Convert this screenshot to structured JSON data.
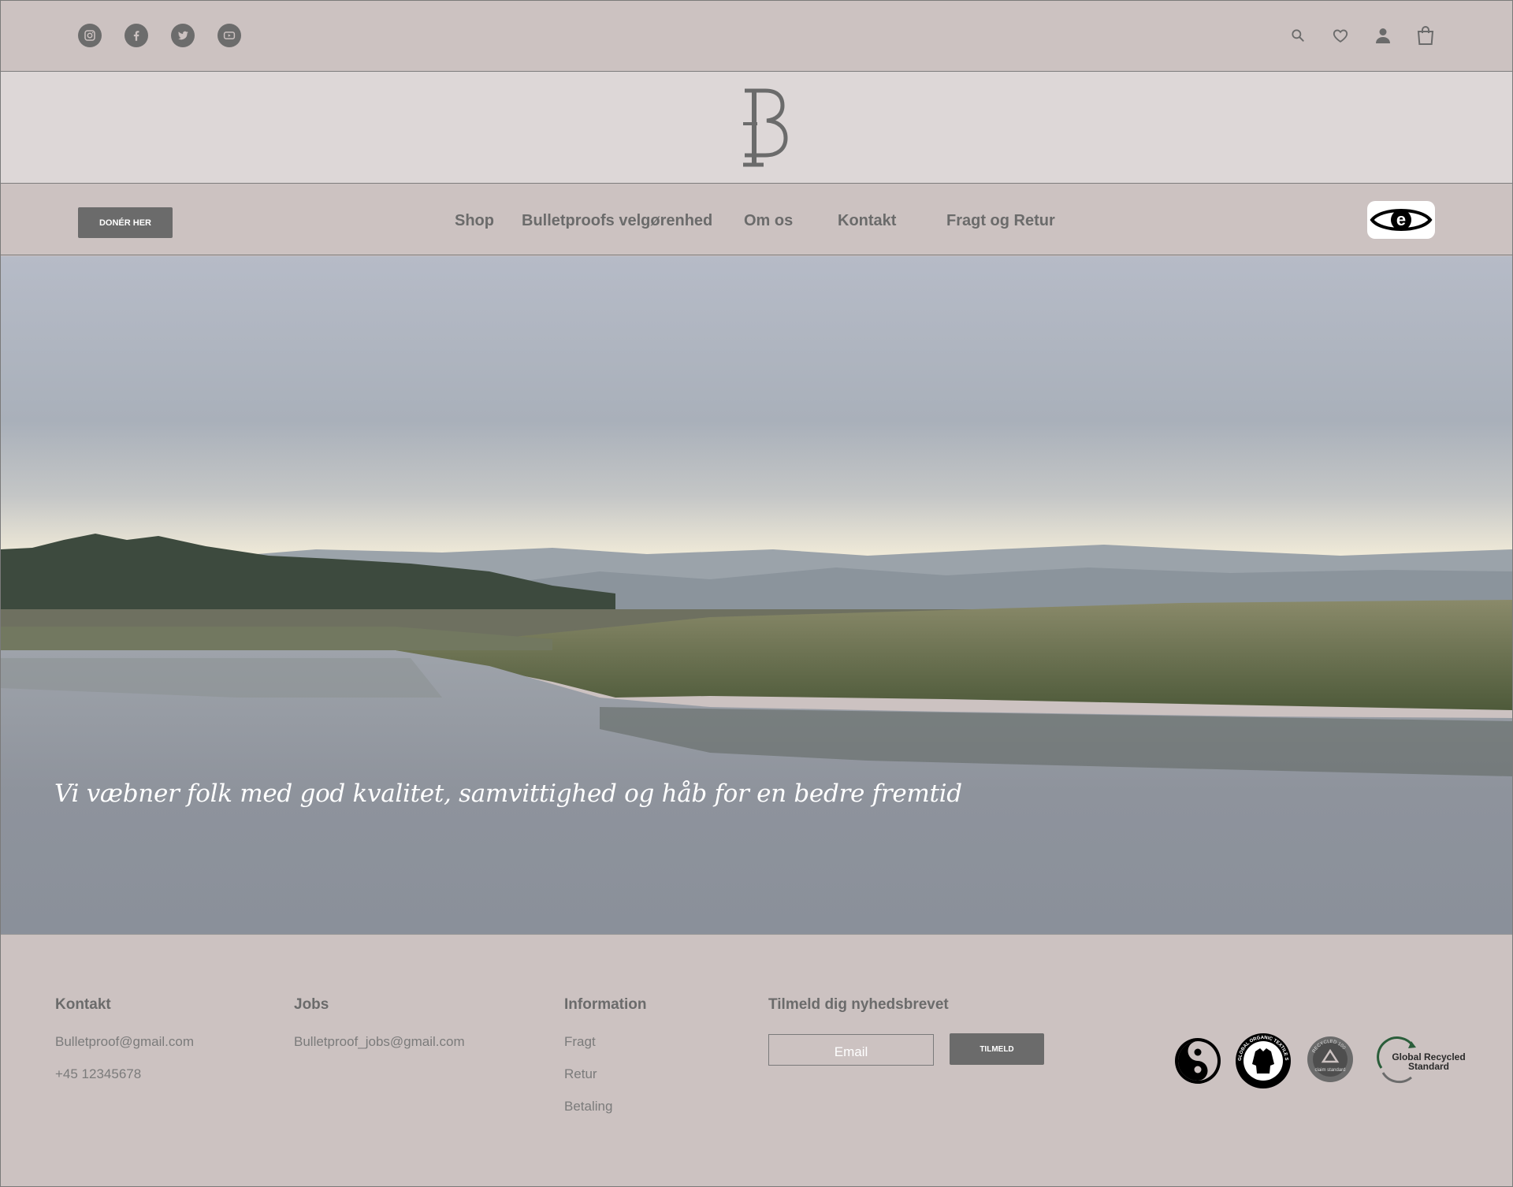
{
  "header": {
    "social_icons": [
      "instagram-icon",
      "facebook-icon",
      "twitter-icon",
      "youtube-icon"
    ],
    "utility_icons": [
      "search-icon",
      "heart-icon",
      "user-icon",
      "bag-icon"
    ]
  },
  "nav": {
    "donate_label": "DONÉR HER",
    "items": [
      {
        "label": "Shop"
      },
      {
        "label": "Bulletproofs velgørenhed"
      },
      {
        "label": "Om os"
      },
      {
        "label": "Kontakt"
      },
      {
        "label": "Fragt og Retur"
      }
    ],
    "badge_letter": "e"
  },
  "hero": {
    "tagline": "Vi væbner folk med god kvalitet, samvittighed og håb for en bedre fremtid"
  },
  "footer": {
    "contact": {
      "title": "Kontakt",
      "email": "Bulletproof@gmail.com",
      "phone": "+45 12345678"
    },
    "jobs": {
      "title": "Jobs",
      "email": "Bulletproof_jobs@gmail.com"
    },
    "information": {
      "title": "Information",
      "links": [
        "Fragt",
        "Retur",
        "Betaling"
      ]
    },
    "newsletter": {
      "title": "Tilmeld dig nyhedsbrevet",
      "placeholder": "Email",
      "button": "TILMELD"
    },
    "certifications": {
      "gots_text": "GLOBAL ORGANIC TEXTILE STANDARD · GOTS ·",
      "recycled_claim_top": "RECYCLED 100",
      "recycled_claim_bottom": "claim standard",
      "grs_line1": "Global Recycled",
      "grs_line2": "Standard"
    }
  },
  "colors": {
    "background": "#ccc2c1",
    "logo_band": "#ddd7d7",
    "button": "#6b6b6b",
    "text": "#6b6b6b"
  }
}
